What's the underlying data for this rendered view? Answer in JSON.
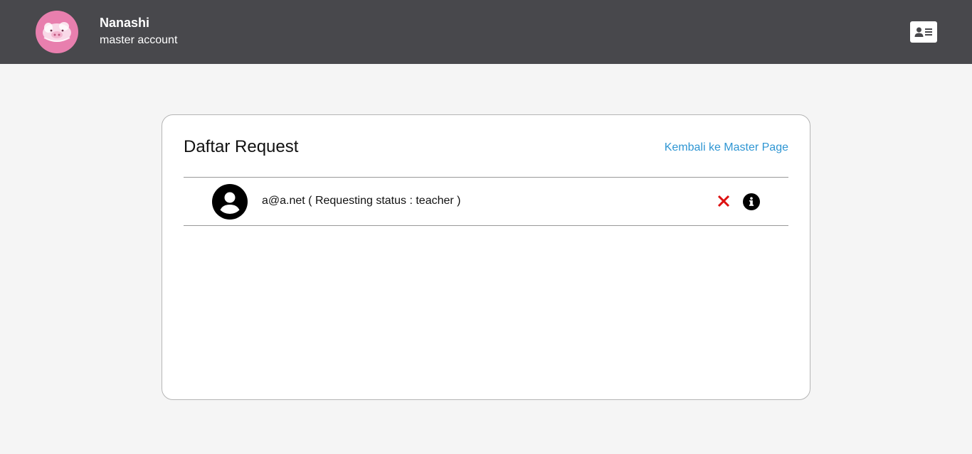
{
  "header": {
    "user_name": "Nanashi",
    "user_role": "master account",
    "avatar_icon": "pig-avatar-icon",
    "profile_icon": "id-card-icon",
    "colors": {
      "bar": "#48484c",
      "avatar_bg": "#e87fae"
    }
  },
  "main": {
    "title": "Daftar Request",
    "back_link": "Kembali ke Master Page",
    "requests": [
      {
        "text": "a@a.net ( Requesting status : teacher )",
        "avatar_icon": "user-circle-icon",
        "reject_icon": "x-icon",
        "info_icon": "info-circle-icon"
      }
    ],
    "colors": {
      "link": "#2f96d3",
      "reject": "#dd1111"
    }
  }
}
